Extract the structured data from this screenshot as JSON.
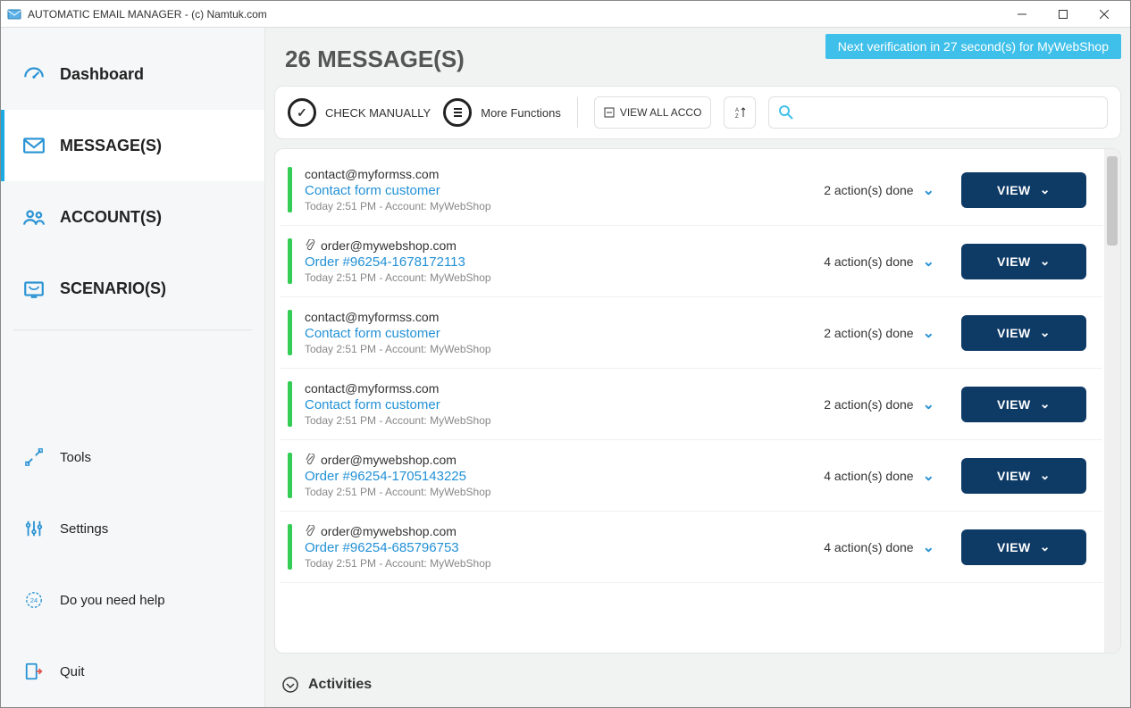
{
  "window": {
    "title": "AUTOMATIC EMAIL MANAGER - (c) Namtuk.com"
  },
  "notification": "Next verification in 27 second(s) for MyWebShop",
  "page_title": "26 MESSAGE(S)",
  "sidebar": {
    "items": [
      {
        "label": "Dashboard"
      },
      {
        "label": "MESSAGE(S)",
        "active": true
      },
      {
        "label": "ACCOUNT(S)"
      },
      {
        "label": "SCENARIO(S)"
      }
    ],
    "tools": "Tools",
    "settings": "Settings",
    "help": "Do you need help",
    "quit": "Quit"
  },
  "toolbar": {
    "check": "CHECK MANUALLY",
    "more": "More Functions",
    "filter": "VIEW ALL ACCO",
    "search_placeholder": ""
  },
  "messages": [
    {
      "from": "contact@myformss.com",
      "subject": "Contact form customer",
      "meta": "Today 2:51 PM - Account: MyWebShop",
      "actions": "2 action(s) done",
      "attach": false
    },
    {
      "from": "order@mywebshop.com",
      "subject": "Order #96254-1678172113",
      "meta": "Today 2:51 PM - Account: MyWebShop",
      "actions": "4 action(s) done",
      "attach": true
    },
    {
      "from": "contact@myformss.com",
      "subject": "Contact form customer",
      "meta": "Today 2:51 PM - Account: MyWebShop",
      "actions": "2 action(s) done",
      "attach": false
    },
    {
      "from": "contact@myformss.com",
      "subject": "Contact form customer",
      "meta": "Today 2:51 PM - Account: MyWebShop",
      "actions": "2 action(s) done",
      "attach": false
    },
    {
      "from": "order@mywebshop.com",
      "subject": "Order #96254-1705143225",
      "meta": "Today 2:51 PM - Account: MyWebShop",
      "actions": "4 action(s) done",
      "attach": true
    },
    {
      "from": "order@mywebshop.com",
      "subject": "Order #96254-685796753",
      "meta": "Today 2:51 PM - Account: MyWebShop",
      "actions": "4 action(s) done",
      "attach": true
    }
  ],
  "view_label": "VIEW",
  "activities_label": "Activities"
}
